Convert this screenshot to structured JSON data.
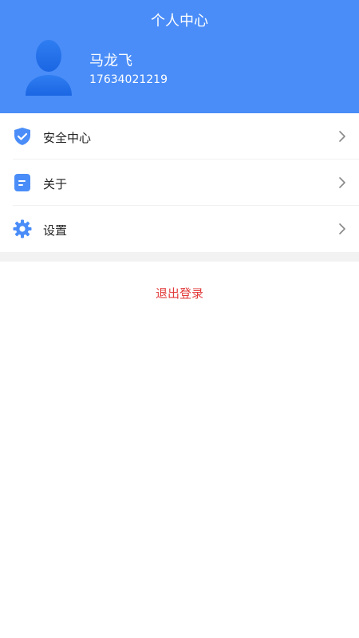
{
  "header": {
    "title": "个人中心",
    "background_color": "#4a8df8",
    "avatar_icon": "user-avatar-icon"
  },
  "user": {
    "name": "马龙飞",
    "phone": "17634021219"
  },
  "menu": {
    "items": [
      {
        "label": "安全中心",
        "icon": "shield-check-icon"
      },
      {
        "label": "关于",
        "icon": "about-icon"
      },
      {
        "label": "设置",
        "icon": "gear-icon"
      }
    ],
    "icon_color": "#4a8df8",
    "chevron_icon": "chevron-right-icon"
  },
  "logout": {
    "label": "退出登录",
    "color": "#e23b3b"
  }
}
